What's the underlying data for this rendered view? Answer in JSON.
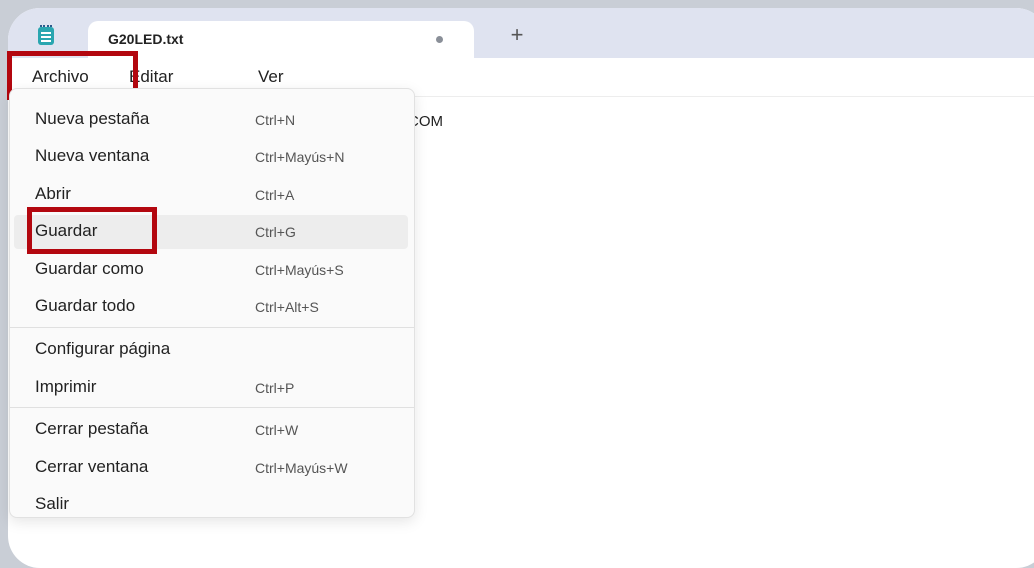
{
  "tab": {
    "title": "G20LED.txt",
    "new_tab": "+"
  },
  "menubar": {
    "archivo": "Archivo",
    "editar": "Editar",
    "ver": "Ver"
  },
  "editor": {
    "visible_text": "COM"
  },
  "file_menu": {
    "items": [
      {
        "label": "Nueva pestaña",
        "shortcut": "Ctrl+N"
      },
      {
        "label": "Nueva ventana",
        "shortcut": "Ctrl+Mayús+N"
      },
      {
        "label": "Abrir",
        "shortcut": "Ctrl+A"
      },
      {
        "label": "Guardar",
        "shortcut": "Ctrl+G"
      },
      {
        "label": "Guardar como",
        "shortcut": "Ctrl+Mayús+S"
      },
      {
        "label": "Guardar todo",
        "shortcut": "Ctrl+Alt+S"
      },
      {
        "label": "Configurar página",
        "shortcut": ""
      },
      {
        "label": "Imprimir",
        "shortcut": "Ctrl+P"
      },
      {
        "label": "Cerrar pestaña",
        "shortcut": "Ctrl+W"
      },
      {
        "label": "Cerrar ventana",
        "shortcut": "Ctrl+Mayús+W"
      },
      {
        "label": "Salir",
        "shortcut": ""
      }
    ]
  },
  "colors": {
    "highlight_box": "#b3070f",
    "titlebar": "#dfe3f0",
    "hover": "#ededed"
  }
}
